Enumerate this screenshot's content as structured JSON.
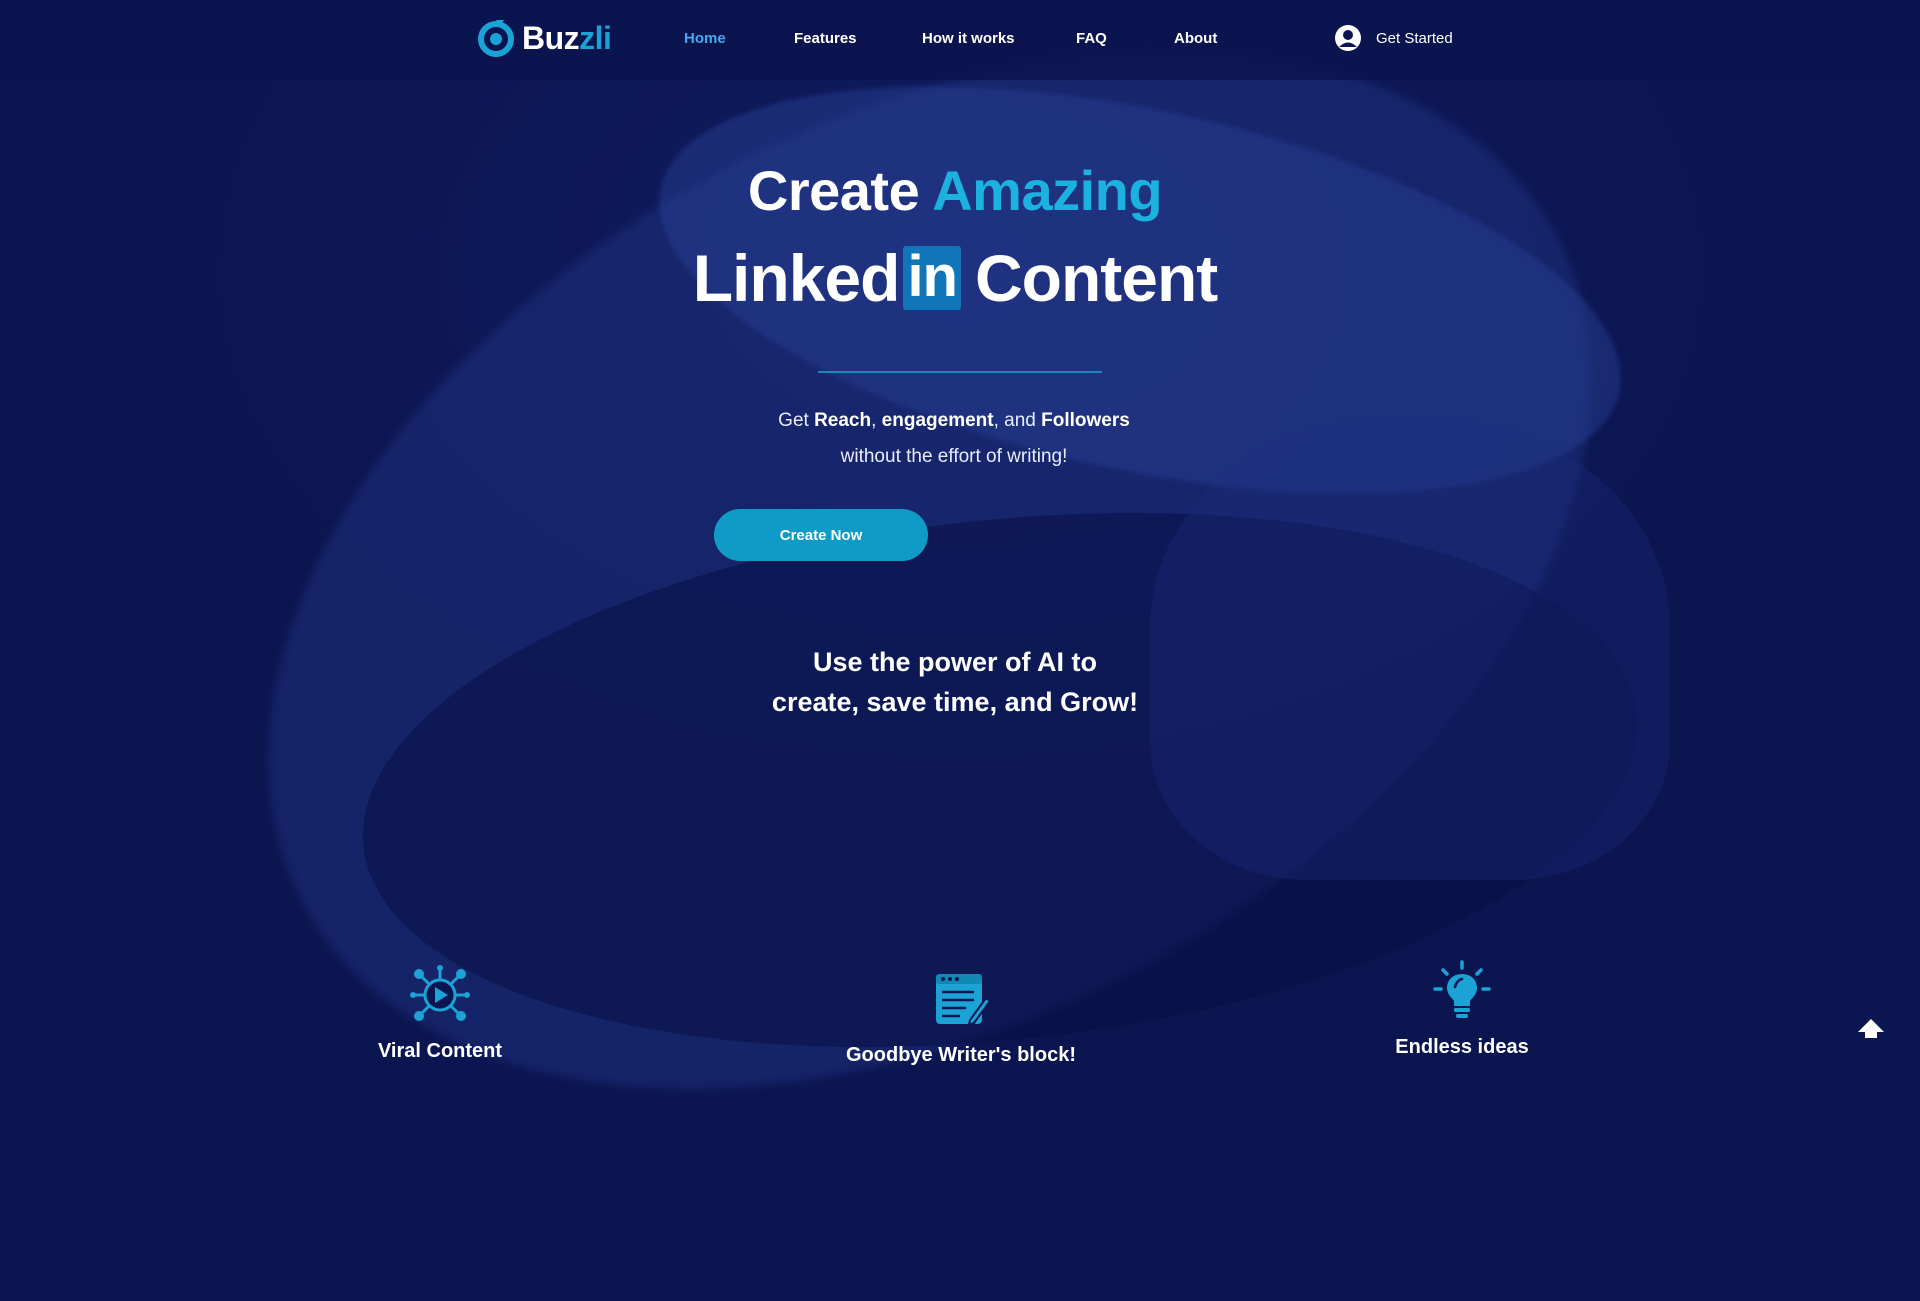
{
  "brand": {
    "name_part1": "Buz",
    "name_part2": "zli",
    "colors": {
      "primary": "#1aa3d4",
      "background": "#0b1550",
      "accent_text": "#1cb2e0",
      "nav_active": "#4aa8f0",
      "linkedin": "#1176b8"
    }
  },
  "nav": {
    "items": [
      {
        "label": "Home",
        "active": true
      },
      {
        "label": "Features",
        "active": false
      },
      {
        "label": "How it works",
        "active": false
      },
      {
        "label": "FAQ",
        "active": false
      },
      {
        "label": "About",
        "active": false
      }
    ],
    "get_started": {
      "label": "Get Started",
      "icon": "user-avatar-icon"
    }
  },
  "hero": {
    "line1_plain": "Create",
    "line1_accent": "Amazing",
    "line2_word1": "Linked",
    "line2_badge": "in",
    "line2_word2": "Content",
    "sub_get": "Get",
    "sub_reach": "Reach",
    "sub_comma": ",",
    "sub_engagement": "engagement",
    "sub_and": ", and",
    "sub_followers": "Followers",
    "sub_line2": "without the effort of writing!",
    "cta_label": "Create Now",
    "tagline_line1": "Use the power of AI to",
    "tagline_line2": "create, save time, and Grow!"
  },
  "features": [
    {
      "title": "Viral Content",
      "icon": "viral-network-play-icon"
    },
    {
      "title": "Goodbye Writer's block!",
      "icon": "notepad-pencil-icon"
    },
    {
      "title": "Endless ideas",
      "icon": "lightbulb-icon"
    }
  ],
  "scroll_top": {
    "icon": "arrow-up-icon"
  }
}
